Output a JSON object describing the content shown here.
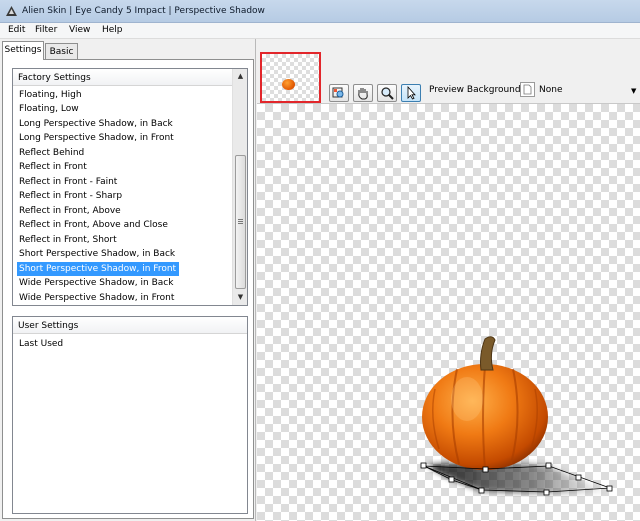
{
  "window": {
    "title": "Alien Skin | Eye Candy 5 Impact | Perspective Shadow"
  },
  "menu": [
    "Edit",
    "Filter",
    "View",
    "Help"
  ],
  "tabs": [
    {
      "label": "Settings",
      "active": true
    },
    {
      "label": "Basic",
      "active": false
    }
  ],
  "factory_settings": {
    "header": "Factory Settings",
    "items": [
      "Floating, High",
      "Floating, Low",
      "Long Perspective Shadow, in Back",
      "Long Perspective Shadow, in Front",
      "Reflect Behind",
      "Reflect in Front",
      "Reflect in Front - Faint",
      "Reflect in Front - Sharp",
      "Reflect in Front, Above",
      "Reflect in Front, Above and Close",
      "Reflect in Front, Short",
      "Short Perspective Shadow, in Back",
      "Short Perspective Shadow, in Front",
      "Wide Perspective Shadow, in Back",
      "Wide Perspective Shadow, in Front"
    ],
    "selected": "Short Perspective Shadow, in Front"
  },
  "user_settings": {
    "header": "User Settings",
    "items": [
      "Last Used"
    ]
  },
  "toolbar": {
    "tools": [
      "zoom-navigator-icon",
      "hand-icon",
      "magnifier-icon",
      "arrow-pointer-icon"
    ],
    "active_tool": "arrow-pointer-icon"
  },
  "preview_background": {
    "label": "Preview Background:",
    "value": "None"
  },
  "colors": {
    "selection": "#3399ff",
    "thumb_border": "#e2262b",
    "pumpkin": "#e8650c"
  }
}
